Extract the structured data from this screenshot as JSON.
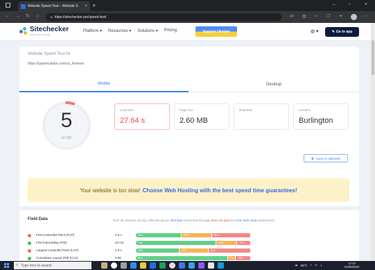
{
  "browser": {
    "tab_title": "Website Speed Test – Website S",
    "tab_close": "×",
    "new_tab": "+",
    "url": "https://sitechecker.pro/speed-test/",
    "window_minimize": "–",
    "window_maximize": "▫",
    "window_close": "×"
  },
  "header": {
    "logo_name": "Sitechecker",
    "logo_tagline": "Simply rank in Google",
    "nav": [
      {
        "label": "Platform ▾"
      },
      {
        "label": "Resources ▾"
      },
      {
        "label": "Solutions ▾"
      },
      {
        "label": "Pricing"
      }
    ],
    "support_button": "Support Ukraine",
    "globe_label": "◍ ▾",
    "goapp_button": "Go to app"
  },
  "speed_test": {
    "title": "Website Speed Test for",
    "url": "https://quanticalabs.com/ua_themes/",
    "tabs": {
      "mobile": "Mobile",
      "desktop": "Desktop"
    },
    "score": 5,
    "score_max": "of 100",
    "score_fraction": 0.05,
    "metrics": [
      {
        "label": "Load time",
        "value": "27.64 s"
      },
      {
        "label": "Page size",
        "value": "2.60 MB"
      },
      {
        "label": "Requests",
        "value": ""
      },
      {
        "label": "Location",
        "value": "Burlington"
      }
    ],
    "copy_button": "Copy to clipboard"
  },
  "banner": {
    "text": "Your website is too slow!",
    "link": "Choose Web Hosting with the best speed time guarantees!"
  },
  "field_data": {
    "title": "Field Data",
    "desc_pre": "Over the previous 28-day collection period,",
    "desc_link": "field data",
    "desc_mid": "shows that this page",
    "desc_fail": "does not pass",
    "desc_post": "the",
    "desc_link2": "Core Web Vitals",
    "desc_end": "assessment.",
    "rows": [
      {
        "name": "First Contentful Paint (FCP)",
        "value": "3.6 s",
        "status": "#e8735b",
        "segments": [
          {
            "label": "40%",
            "pct": 40
          },
          {
            "label": "26%",
            "pct": 26
          },
          {
            "label": "34%",
            "pct": 34
          }
        ]
      },
      {
        "name": "First Input Delay (FID)",
        "value": "42 ms",
        "status": "#3fbf6a",
        "segments": [
          {
            "label": "70%",
            "pct": 70
          },
          {
            "label": "18%",
            "pct": 18
          },
          {
            "label": "12%",
            "pct": 12
          }
        ]
      },
      {
        "name": "Largest Contentful Paint (LCP)",
        "value": "4.9 s",
        "status": "#e8735b",
        "segments": [
          {
            "label": "38%",
            "pct": 38
          },
          {
            "label": "25%",
            "pct": 25
          },
          {
            "label": "37%",
            "pct": 37
          }
        ]
      },
      {
        "name": "Cumulative Layout Shift (CLS)",
        "value": "0.06",
        "status": "#3fbf6a",
        "segments": [
          {
            "label": "80%",
            "pct": 80
          },
          {
            "label": "7%",
            "pct": 7
          },
          {
            "label": "13%",
            "pct": 13
          }
        ]
      }
    ]
  },
  "colors": {
    "good": "#5fd08a",
    "avg": "#f5b45a",
    "poor": "#f08a8a",
    "accent": "#3b7bea"
  },
  "taskbar": {
    "search_placeholder": "Type here to search",
    "temperature": "29°C",
    "time": "17:07",
    "date": "01/06/2022"
  }
}
